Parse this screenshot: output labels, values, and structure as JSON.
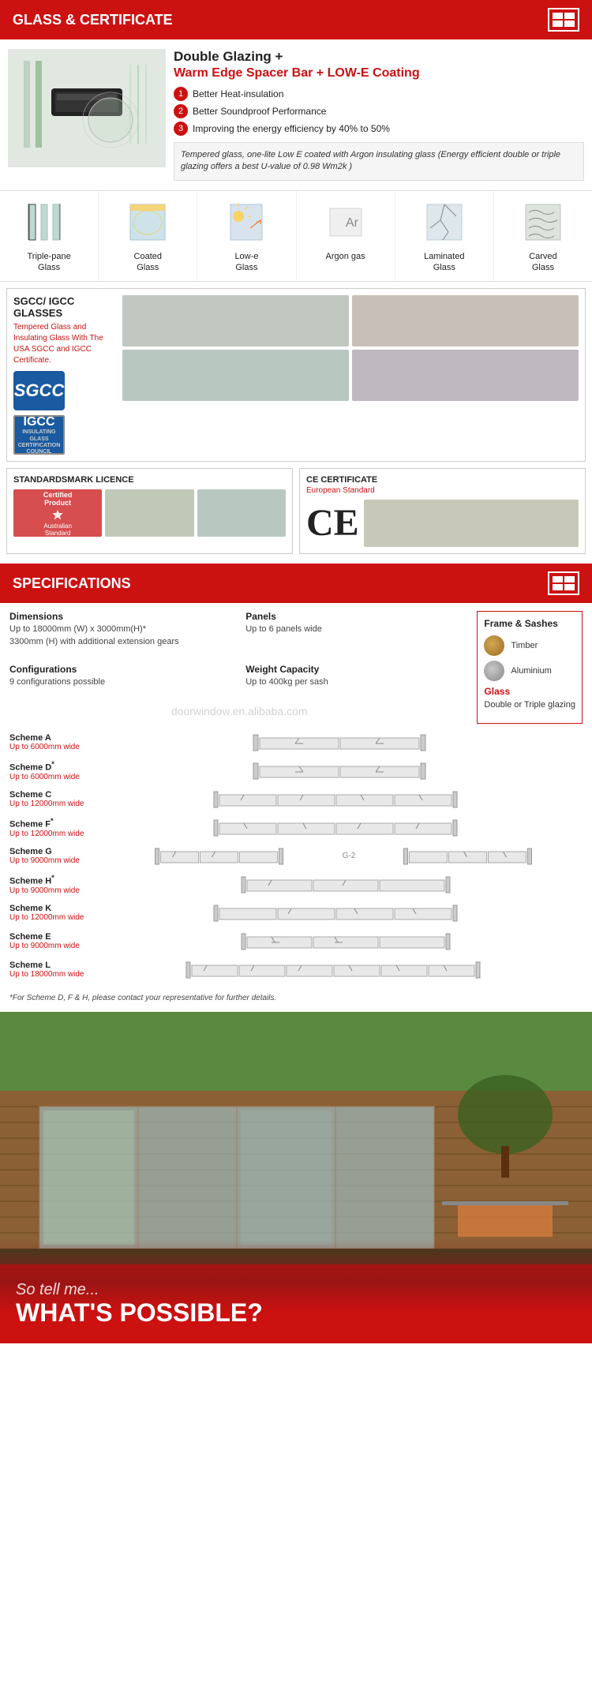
{
  "glass_cert": {
    "header": "GLASS & CERTIFICATE",
    "double_glazing": {
      "title_main": "Double Glazing +",
      "title_sub": "Warm Edge Spacer Bar + LOW-E Coating",
      "features": [
        "Better Heat-insulation",
        "Better Soundproof Performance",
        "Improving the energy efficiency by 40% to 50%"
      ],
      "note": "Tempered glass, one-lite Low E coated with Argon insulating glass (Energy efficient double or triple glazing offers a best U-value of 0.98 Wm2k )"
    },
    "glass_types": [
      {
        "label": "Triple-pane\nGlass",
        "icon": "triple-pane"
      },
      {
        "label": "Coated\nGlass",
        "icon": "coated"
      },
      {
        "label": "Low-e\nGlass",
        "icon": "lowe"
      },
      {
        "label": "Argon gas",
        "icon": "argon"
      },
      {
        "label": "Laminated\nGlass",
        "icon": "laminated"
      },
      {
        "label": "Carved\nGlass",
        "icon": "carved"
      }
    ],
    "sgcc": {
      "title": "SGCC/ IGCC\nGLASSES",
      "description": "Tempered Glass and Insulating Glass With The USA SGCC and IGCC Certificate."
    },
    "standards": {
      "title": "STANDARDSMARK LICENCE",
      "sub": "Australian\nStandard"
    },
    "ce": {
      "title": "CE CERTIFICATE",
      "subtitle": "European Standard"
    }
  },
  "specs": {
    "header": "SPECIFICATIONS",
    "dimensions": {
      "label": "Dimensions",
      "value": "Up to 18000mm (W) x 3000mm(H)*\n3300mm (H) with additional extension gears"
    },
    "configurations": {
      "label": "Configurations",
      "value": "9 configurations possible"
    },
    "panels": {
      "label": "Panels",
      "value": "Up to 6 panels wide"
    },
    "weight": {
      "label": "Weight Capacity",
      "value": "Up to 400kg per sash"
    },
    "frame_sashes": {
      "title": "Frame & Sashes",
      "timber": "Timber",
      "aluminium": "Aluminium",
      "glass_title": "Glass",
      "glass_type": "Double or Triple glazing"
    },
    "watermark": "doorwindow.en.alibaba.com",
    "schemes": [
      {
        "name": "Scheme A",
        "width": "Up to 6000mm wide",
        "type": "A",
        "panels": 2
      },
      {
        "name": "Scheme D*",
        "width": "Up to 6000mm wide",
        "type": "D",
        "panels": 2
      },
      {
        "name": "Scheme C",
        "width": "Up to 12000mm wide",
        "type": "C",
        "panels": 4
      },
      {
        "name": "Scheme F*",
        "width": "Up to 12000mm wide",
        "type": "F",
        "panels": 4
      },
      {
        "name": "Scheme G",
        "width": "Up to 9000mm wide",
        "type": "G",
        "panels": 3,
        "label2": "G-2",
        "panels2": 3
      },
      {
        "name": "Scheme H*",
        "width": "Up to 9000mm wide",
        "type": "H",
        "panels": 3
      },
      {
        "name": "Scheme K",
        "width": "Up to 12000mm wide",
        "type": "K",
        "panels": 4
      },
      {
        "name": "Scheme E",
        "width": "Up to 9000mm wide",
        "type": "E",
        "panels": 3
      },
      {
        "name": "Scheme L",
        "width": "Up to 18000mm wide",
        "type": "L",
        "panels": 6
      }
    ],
    "footnote": "*For Scheme D, F & H, please contact your representative for further details."
  },
  "bottom": {
    "tell_me": "So tell me...",
    "whats_possible": "WHAT'S POSSIBLE?"
  }
}
